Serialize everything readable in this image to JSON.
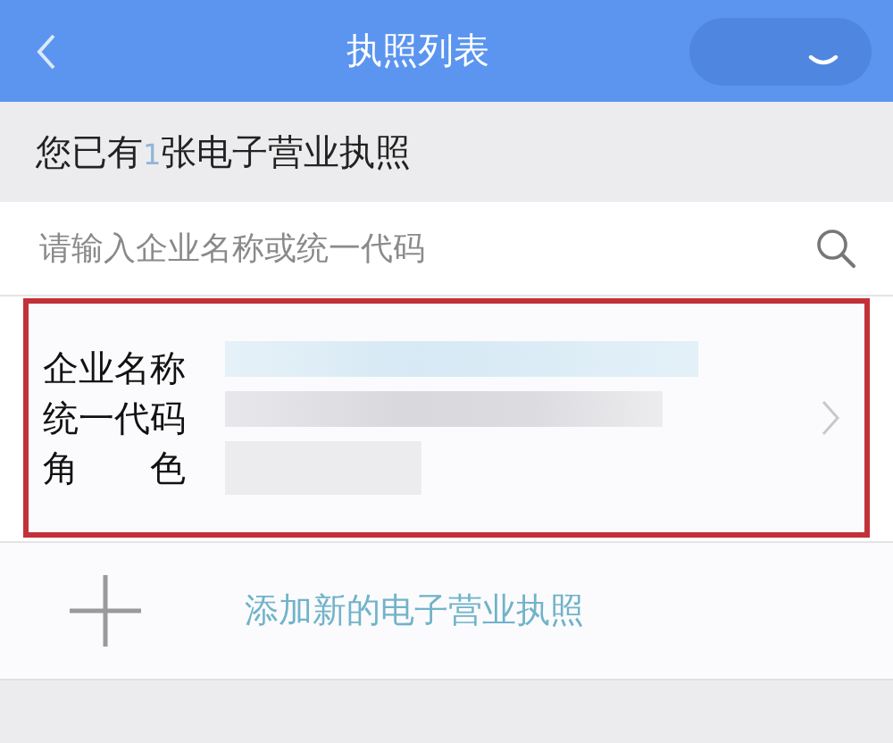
{
  "window": {
    "title": "执照列表"
  },
  "summary": {
    "prefix": "您已有",
    "count": "1",
    "suffix": "张电子营业执照"
  },
  "search": {
    "placeholder": "请输入企业名称或统一代码"
  },
  "licenses": [
    {
      "labels": [
        "企业名称",
        "统一代码",
        "角　　色"
      ],
      "highlighted": true
    }
  ],
  "add_action": {
    "label": "添加新的电子营业执照"
  }
}
